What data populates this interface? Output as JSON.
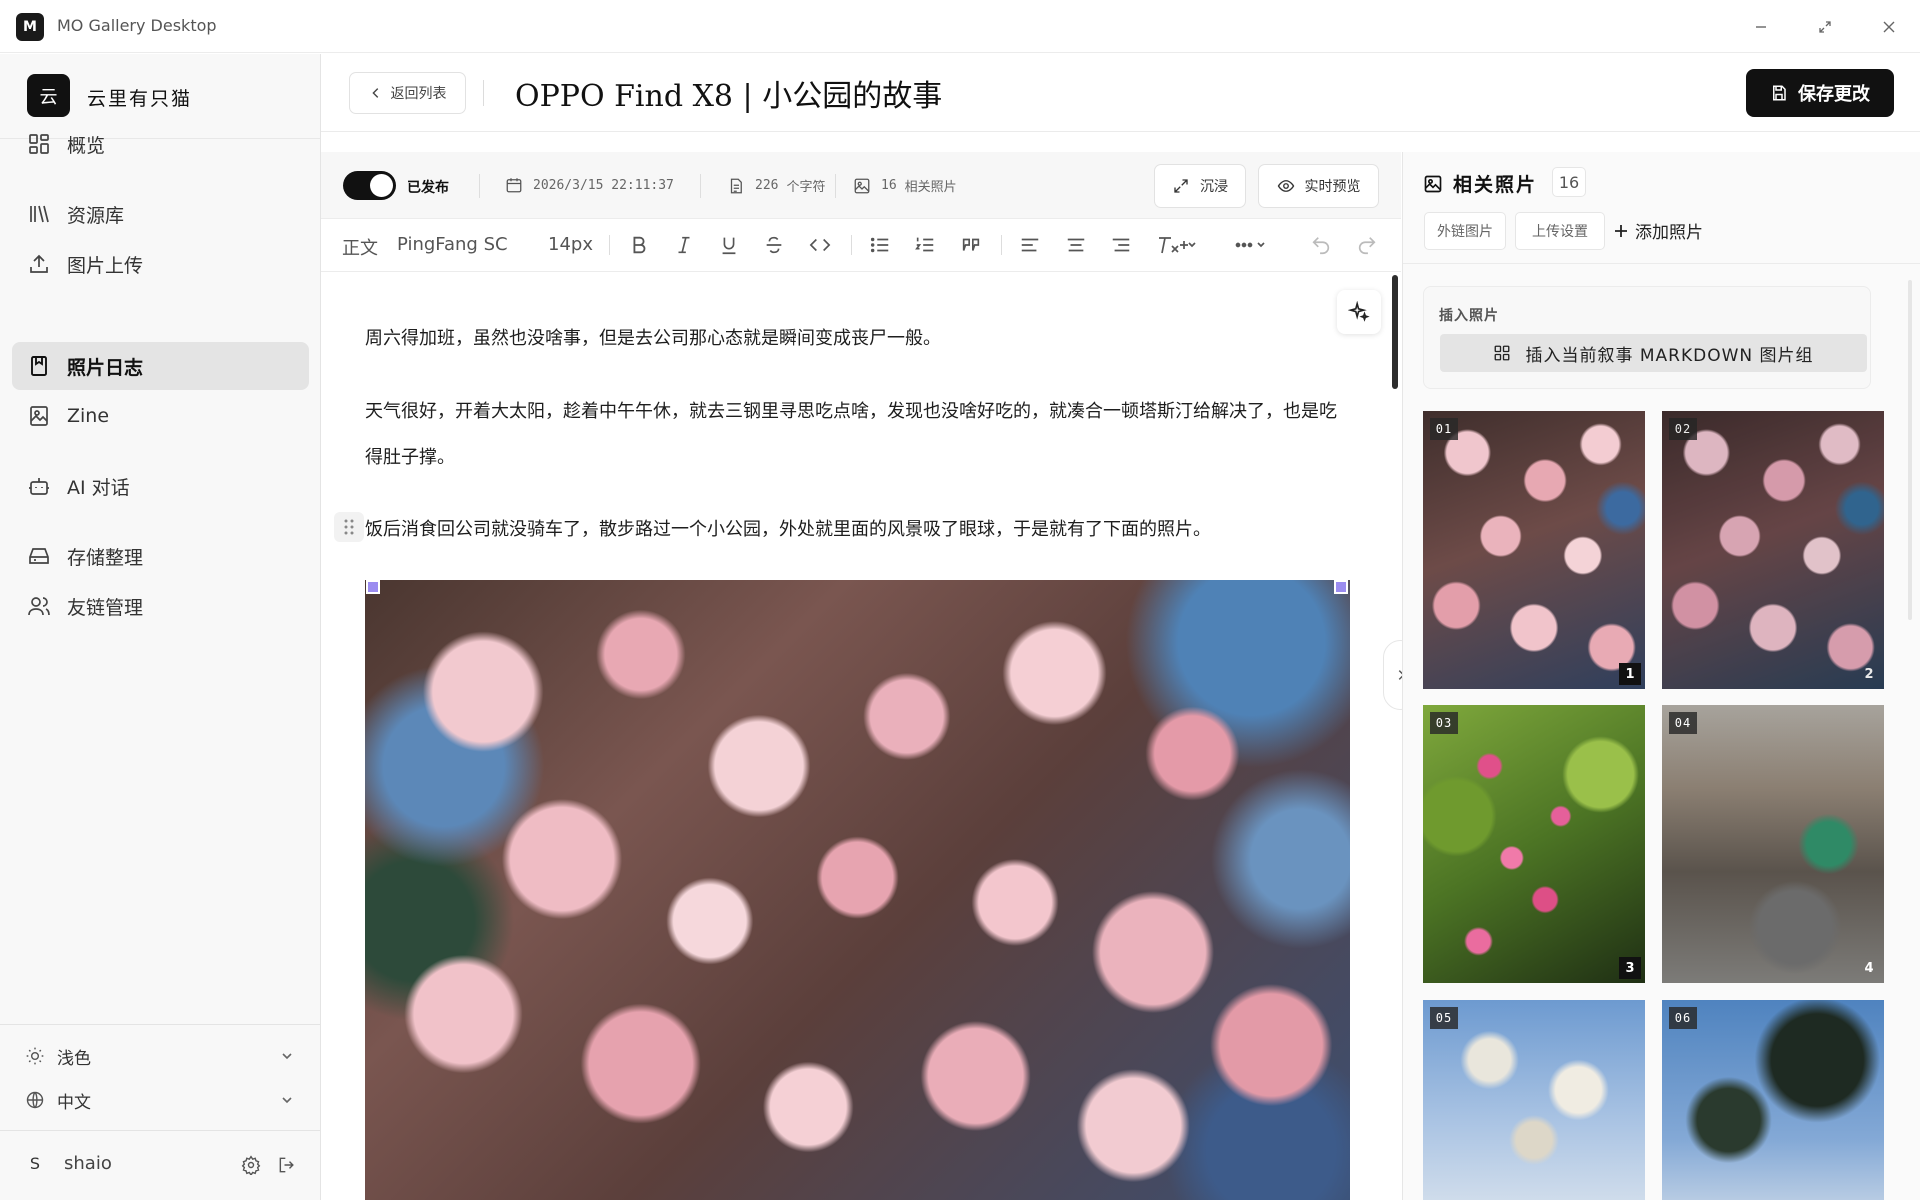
{
  "app": {
    "logo_letter": "M",
    "title": "MO Gallery Desktop"
  },
  "sidebar": {
    "brand_initial": "云",
    "brand_name": "云里有只猫",
    "items": [
      {
        "label": "概览",
        "icon": "dashboard-icon"
      },
      {
        "label": "资源库",
        "icon": "library-icon"
      },
      {
        "label": "图片上传",
        "icon": "upload-icon"
      },
      {
        "label": "照片日志",
        "icon": "journal-icon",
        "active": true
      },
      {
        "label": "Zine",
        "icon": "image-icon"
      },
      {
        "label": "AI 对话",
        "icon": "bot-icon"
      },
      {
        "label": "存储整理",
        "icon": "storage-icon"
      },
      {
        "label": "友链管理",
        "icon": "users-icon"
      }
    ],
    "theme_label": "浅色",
    "language_label": "中文",
    "user_initial": "S",
    "user_name": "shaio"
  },
  "header": {
    "back_label": "返回列表",
    "title": "OPPO Find X8 | 小公园的故事",
    "save_label": "保存更改"
  },
  "status": {
    "published_label": "已发布",
    "published": true,
    "datetime": "2026/3/15 22:11:37",
    "word_count": "226",
    "word_unit": "个字符",
    "photo_count": "16",
    "photo_unit": "相关照片",
    "immersive_label": "沉浸",
    "preview_label": "实时预览"
  },
  "toolbar": {
    "paragraph_style": "正文",
    "font_family": "PingFang SC",
    "font_size": "14px"
  },
  "editor": {
    "paragraphs": [
      "周六得加班，虽然也没啥事，但是去公司那心态就是瞬间变成丧尸一般。",
      "天气很好，开着大太阳，趁着中午午休，就去三钢里寻思吃点啥，发现也没啥好吃的，就凑合一顿塔斯汀给解决了，也是吃得肚子撑。",
      "饭后消食回公司就没骑车了，散步路过一个小公园，外处就里面的风景吸了眼球，于是就有了下面的照片。"
    ]
  },
  "right_panel": {
    "title": "相关照片",
    "count": "16",
    "tab_external": "外链图片",
    "tab_upload_settings": "上传设置",
    "add_photo_label": "添加照片",
    "insert_title": "插入照片",
    "insert_button_label": "插入当前叙事 MARKDOWN 图片组",
    "photos": [
      {
        "num": "01",
        "index": "1"
      },
      {
        "num": "02",
        "index": "2"
      },
      {
        "num": "03",
        "index": "3"
      },
      {
        "num": "04",
        "index": "4"
      },
      {
        "num": "05",
        "index": ""
      },
      {
        "num": "06",
        "index": ""
      }
    ]
  },
  "colors": {
    "accent": "#111111",
    "handle": "#9b8cf0",
    "active_nav_bg": "#e4e4e4"
  }
}
